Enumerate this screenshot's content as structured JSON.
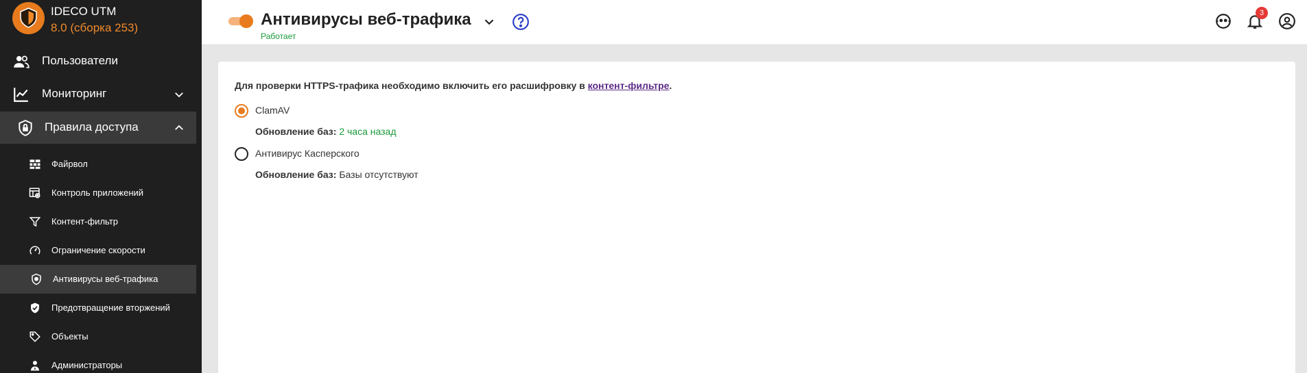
{
  "brand": {
    "name": "IDECO UTM",
    "version": "8.0 (сборка 253)"
  },
  "sidebar": {
    "items": [
      {
        "label": "Пользователи",
        "icon": "users-icon"
      },
      {
        "label": "Мониторинг",
        "icon": "chart-icon",
        "expanded": false
      },
      {
        "label": "Правила доступа",
        "icon": "shield-lock-icon",
        "expanded": true
      }
    ],
    "subitems": [
      {
        "label": "Файрвол",
        "icon": "firewall-icon"
      },
      {
        "label": "Контроль приложений",
        "icon": "app-control-icon"
      },
      {
        "label": "Контент-фильтр",
        "icon": "filter-icon"
      },
      {
        "label": "Ограничение скорости",
        "icon": "speed-icon"
      },
      {
        "label": "Антивирусы веб-трафика",
        "icon": "antivirus-shield-icon",
        "current": true
      },
      {
        "label": "Предотвращение вторжений",
        "icon": "shield-check-icon"
      },
      {
        "label": "Объекты",
        "icon": "tag-icon"
      },
      {
        "label": "Администраторы",
        "icon": "admin-icon"
      }
    ]
  },
  "header": {
    "title": "Антивирусы веб-трафика",
    "status": "Работает",
    "enabled": true,
    "notifications_count": "3"
  },
  "content": {
    "notice_text": "Для проверки HTTPS-трафика необходимо включить его расшифровку в ",
    "notice_link": "контент-фильтре",
    "notice_end": ".",
    "options": [
      {
        "label": "ClamAV",
        "selected": true,
        "db_label": "Обновление баз:",
        "db_value": "2 часа назад"
      },
      {
        "label": "Антивирус Касперского",
        "selected": false,
        "db_label": "Обновление баз:",
        "db_value": "Базы отсутствуют"
      }
    ]
  },
  "colors": {
    "accent": "#e87b1e",
    "ok": "#1a9a3a",
    "sidebar_bg": "#1f1f1f",
    "link": "#5b2a86"
  }
}
